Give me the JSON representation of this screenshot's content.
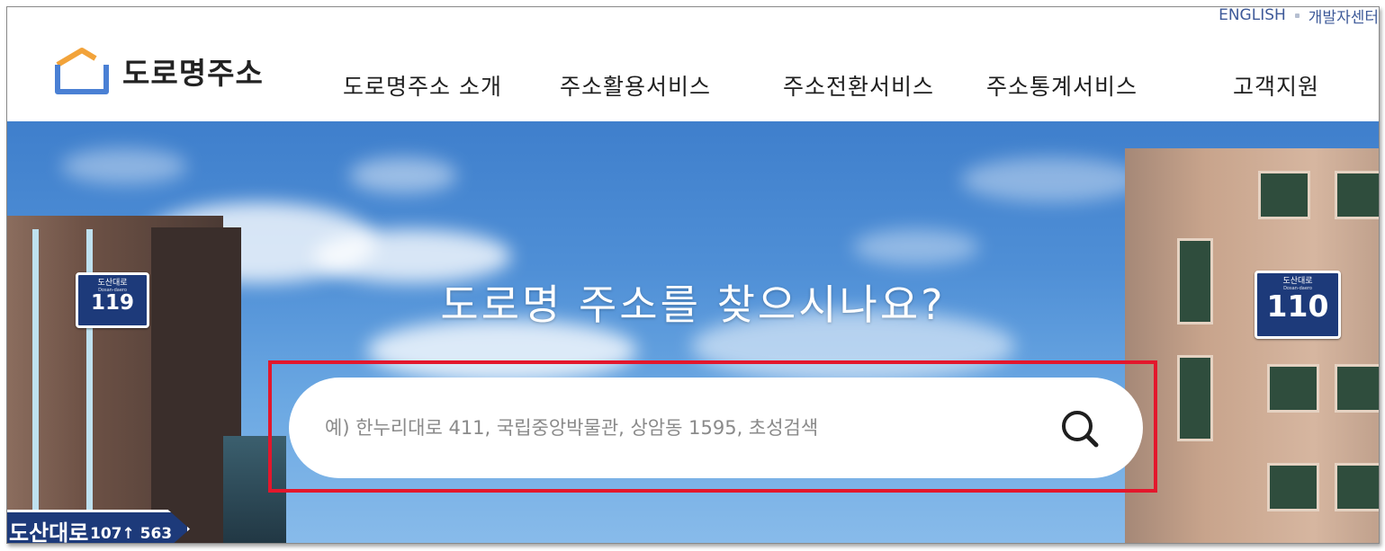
{
  "utility_links": [
    {
      "label": "ENGLISH"
    },
    {
      "label": "개발자센터"
    }
  ],
  "logo": {
    "text": "도로명주소"
  },
  "nav": [
    {
      "label": "도로명주소 소개"
    },
    {
      "label": "주소활용서비스"
    },
    {
      "label": "주소전환서비스"
    },
    {
      "label": "주소통계서비스"
    },
    {
      "label": "고객지원"
    }
  ],
  "hero": {
    "title": "도로명 주소를 찾으시나요?",
    "signs": [
      {
        "name": "도산대로",
        "sub": "Dosan-daero",
        "number": "119"
      },
      {
        "name": "도산대로",
        "sub": "Dosan-daero",
        "number": "110"
      }
    ],
    "road_sign": {
      "name": "도산대로",
      "number": "107↑ 563"
    }
  },
  "search": {
    "placeholder": "예) 한누리대로 411, 국립중앙박물관, 상암동 1595, 초성검색",
    "value": "",
    "icon": "search-icon"
  },
  "colors": {
    "highlight": "#e3172c",
    "sign_blue": "#1d3a7a",
    "logo_orange": "#f2a33a",
    "logo_blue": "#4a80d4"
  }
}
